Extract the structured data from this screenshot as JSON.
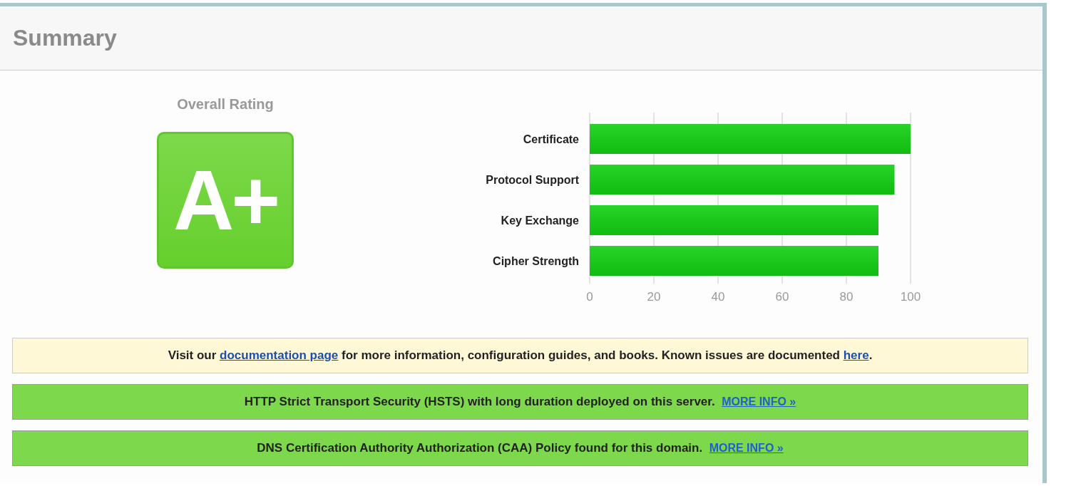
{
  "header": {
    "title": "Summary"
  },
  "rating": {
    "label": "Overall Rating",
    "grade": "A+"
  },
  "chart_data": {
    "type": "bar",
    "orientation": "horizontal",
    "categories": [
      "Certificate",
      "Protocol Support",
      "Key Exchange",
      "Cipher Strength"
    ],
    "series": [
      {
        "color": "#11bb11",
        "values": [
          100,
          95,
          90,
          90
        ]
      }
    ],
    "grid": true,
    "xlim": [
      0,
      100
    ],
    "xticks": [
      0,
      20,
      40,
      60,
      80,
      100
    ]
  },
  "notices": [
    {
      "kind": "info",
      "parts": [
        {
          "kind": "text",
          "text": "Visit our "
        },
        {
          "kind": "link",
          "text": "documentation page"
        },
        {
          "kind": "text",
          "text": " for more information, configuration guides, and books. Known issues are documented "
        },
        {
          "kind": "link",
          "text": "here"
        },
        {
          "kind": "text",
          "text": "."
        }
      ]
    },
    {
      "kind": "good",
      "parts": [
        {
          "kind": "text",
          "text": "HTTP Strict Transport Security (HSTS) with long duration deployed on this server.  "
        },
        {
          "kind": "more",
          "text": "MORE INFO »"
        }
      ]
    },
    {
      "kind": "good",
      "parts": [
        {
          "kind": "text",
          "text": "DNS Certification Authority Authorization (CAA) Policy found for this domain.  "
        },
        {
          "kind": "more",
          "text": "MORE INFO »"
        }
      ]
    }
  ]
}
